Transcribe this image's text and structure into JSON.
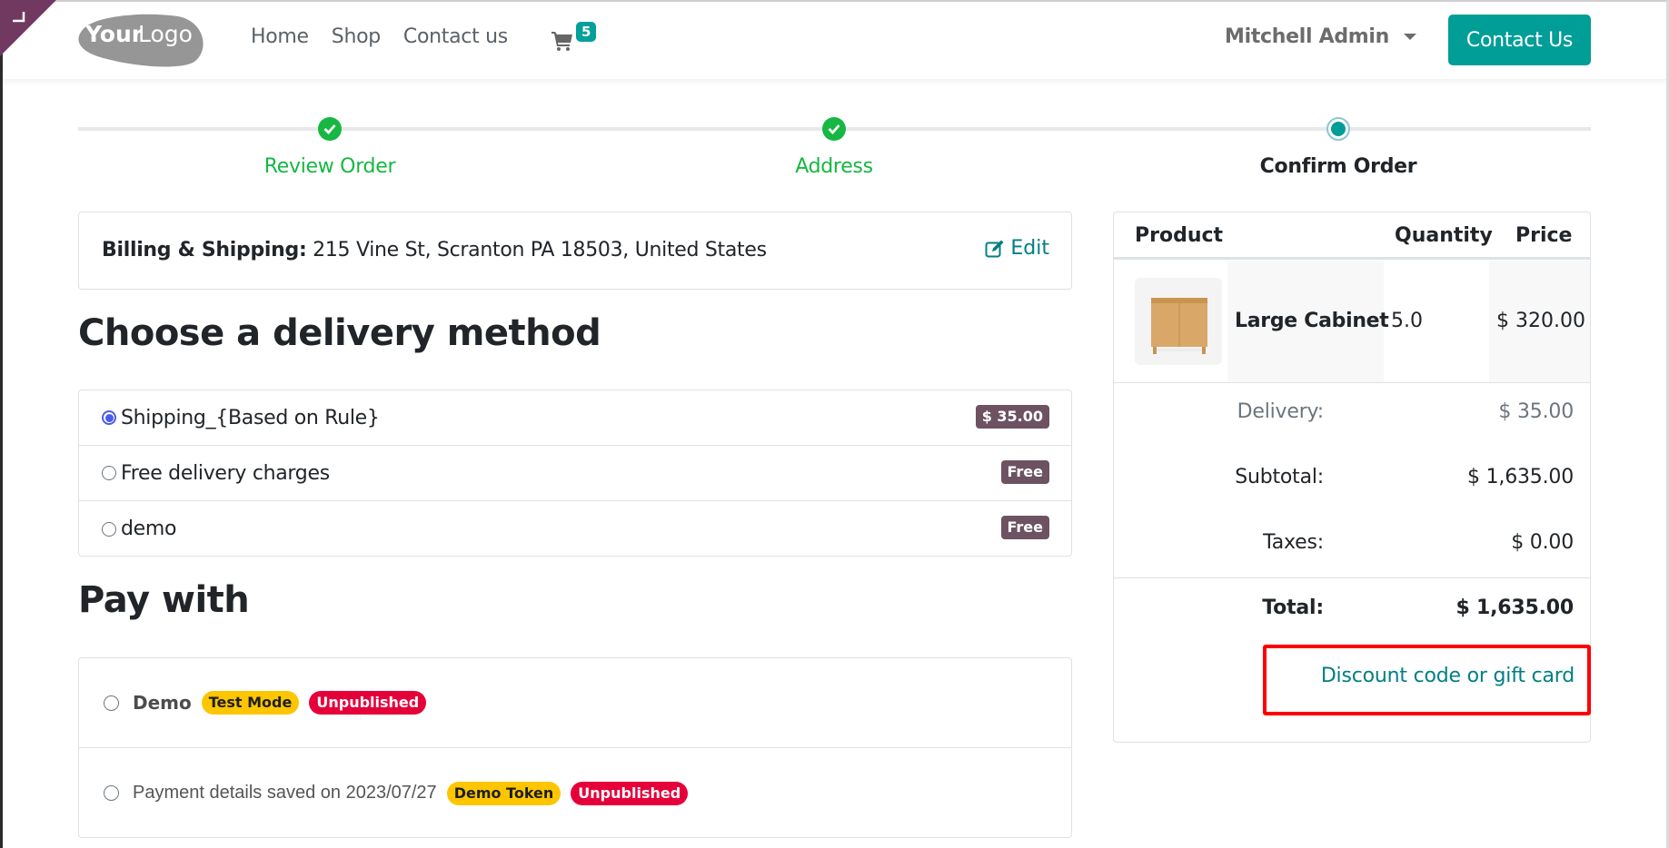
{
  "navbar": {
    "logo_text_bold": "Your",
    "logo_text_light": "Logo",
    "links": [
      {
        "label": "Home"
      },
      {
        "label": "Shop"
      },
      {
        "label": "Contact us"
      }
    ],
    "cart_icon": "shopping-cart-icon",
    "cart_count": "5",
    "user_name": "Mitchell Admin",
    "cta_label": "Contact Us"
  },
  "colors": {
    "primary": "#019e98",
    "link": "#017e84",
    "success": "#16b742",
    "price_badge": "#6d5262",
    "warning": "#fdc600",
    "danger": "#e5003a",
    "highlight": "#ff0000"
  },
  "steps": [
    {
      "label": "Review Order",
      "state": "done"
    },
    {
      "label": "Address",
      "state": "done"
    },
    {
      "label": "Confirm Order",
      "state": "current"
    }
  ],
  "billing": {
    "label": "Billing & Shipping:",
    "address": "215 Vine St, Scranton PA 18503, United States",
    "edit_label": "Edit",
    "edit_icon": "edit-icon"
  },
  "delivery": {
    "title": "Choose a delivery method",
    "methods": [
      {
        "label": "Shipping_{Based on Rule}",
        "price": "$ 35.00",
        "selected": true
      },
      {
        "label": "Free delivery charges",
        "price": "Free",
        "selected": false
      },
      {
        "label": "demo",
        "price": "Free",
        "selected": false
      }
    ]
  },
  "payment": {
    "title": "Pay with",
    "options": [
      {
        "label": "Demo",
        "tags": [
          "Test Mode",
          "Unpublished"
        ]
      },
      {
        "label": "Payment details saved on 2023/07/27",
        "tags": [
          "Demo Token",
          "Unpublished"
        ]
      }
    ]
  },
  "summary": {
    "headers": {
      "product": "Product",
      "quantity": "Quantity",
      "price": "Price"
    },
    "items": [
      {
        "name": "Large Cabinet",
        "quantity": "5.0",
        "price": "$ 320.00",
        "image": "large-cabinet-image"
      }
    ],
    "delivery_label": "Delivery:",
    "delivery_value": "$ 35.00",
    "subtotal_label": "Subtotal:",
    "subtotal_value": "$ 1,635.00",
    "taxes_label": "Taxes:",
    "taxes_value": "$ 0.00",
    "total_label": "Total:",
    "total_value": "$ 1,635.00",
    "discount_label": "Discount code or gift card"
  }
}
